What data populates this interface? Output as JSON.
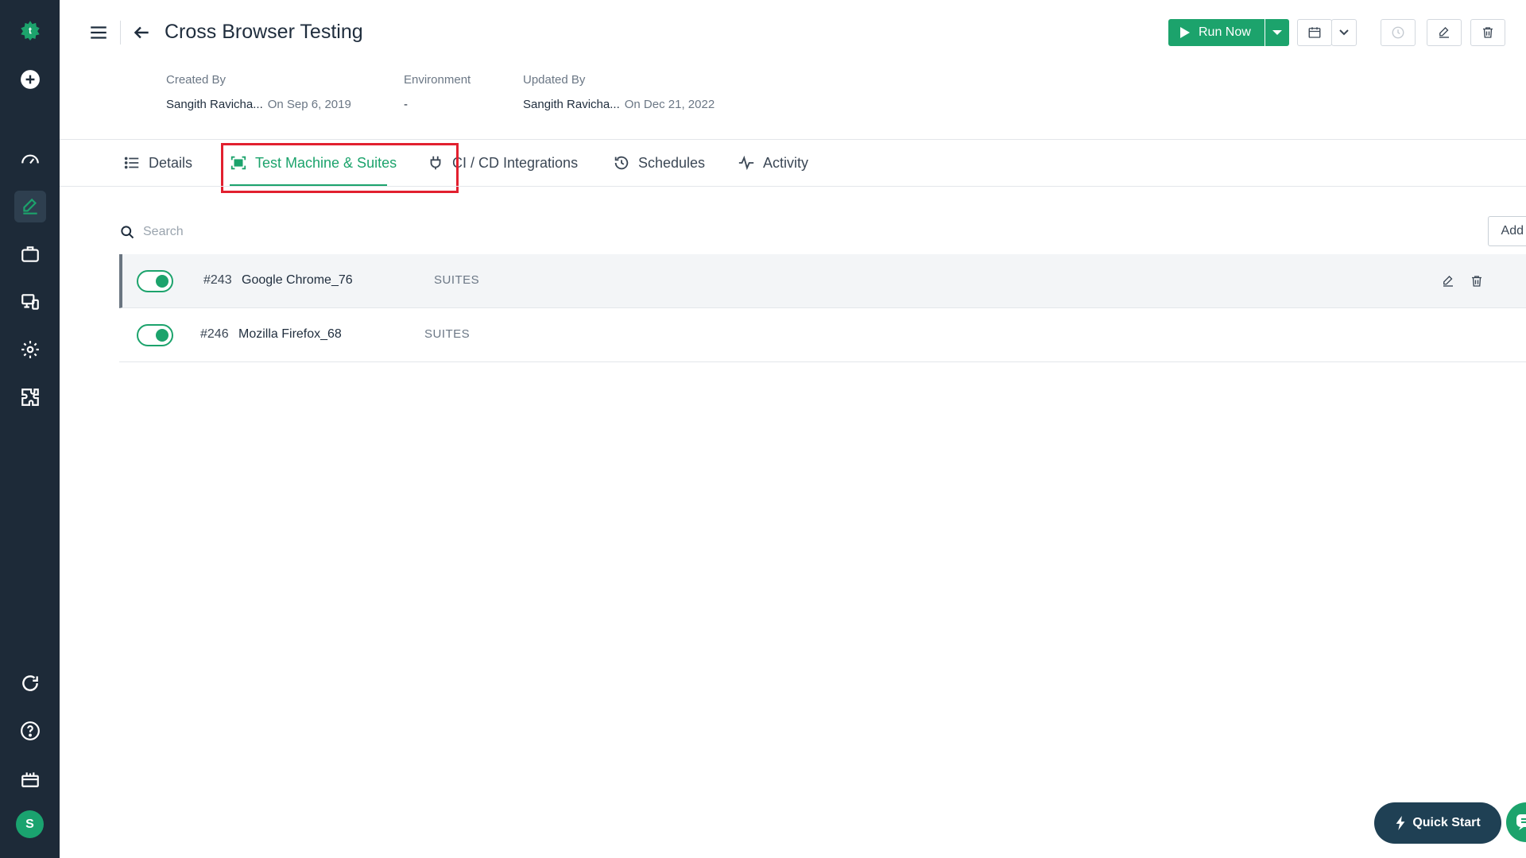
{
  "app": {
    "logo": "testsigma-logo",
    "avatar_initial": "S"
  },
  "sidebar": {
    "items": [
      {
        "name": "add-icon"
      },
      {
        "name": "dashboard-icon"
      },
      {
        "name": "test-development-icon",
        "active": true
      },
      {
        "name": "briefcase-icon"
      },
      {
        "name": "run-results-icon"
      },
      {
        "name": "settings-icon"
      },
      {
        "name": "addons-icon"
      },
      {
        "name": "refresh-icon"
      },
      {
        "name": "help-icon"
      },
      {
        "name": "gift-icon"
      }
    ]
  },
  "header": {
    "title": "Cross Browser Testing",
    "run_now_label": "Run Now"
  },
  "meta": {
    "created_by_label": "Created By",
    "created_by_value": "Sangith Ravicha...",
    "created_on": "On Sep 6, 2019",
    "environment_label": "Environment",
    "environment_value": "-",
    "updated_by_label": "Updated By",
    "updated_by_value": "Sangith Ravicha...",
    "updated_on": "On Dec 21, 2022"
  },
  "tabs": [
    {
      "label": "Details",
      "icon": "list-icon"
    },
    {
      "label": "Test Machine & Suites",
      "icon": "machine-icon",
      "active": true
    },
    {
      "label": "CI / CD Integrations",
      "icon": "plug-icon"
    },
    {
      "label": "Schedules",
      "icon": "clock-icon"
    },
    {
      "label": "Activity",
      "icon": "activity-icon"
    }
  ],
  "search": {
    "placeholder": "Search"
  },
  "add_new_label": "Add New",
  "machines": [
    {
      "id": "#243",
      "name": "Google Chrome_76",
      "tag": "SUITES",
      "enabled": true
    },
    {
      "id": "#246",
      "name": "Mozilla Firefox_68",
      "tag": "SUITES",
      "enabled": true
    }
  ],
  "quick_start_label": "Quick Start",
  "colors": {
    "accent": "#1ca36c",
    "sidebar": "#1d2a38",
    "highlight": "#e2202f"
  }
}
